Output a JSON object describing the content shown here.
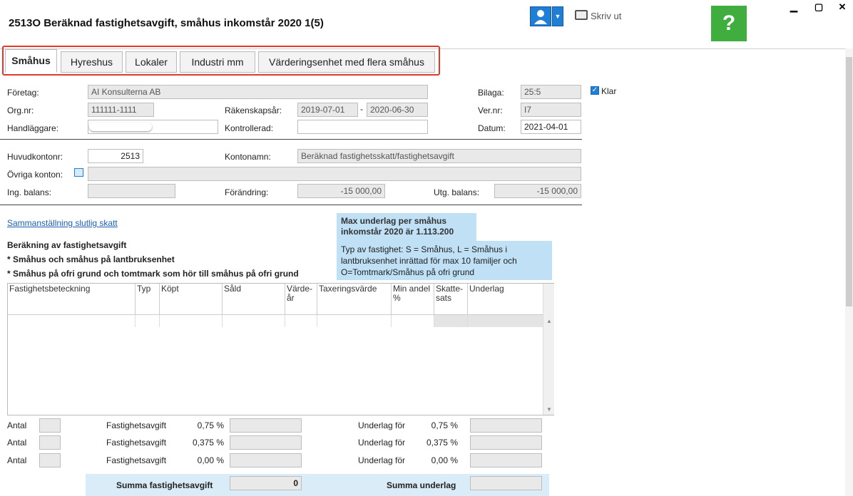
{
  "window": {
    "title": "2513O  Beräknad fastighetsavgift, småhus inkomstår 2020 1(5)",
    "minimize": "▁",
    "maximize": "▢",
    "close": "✕",
    "help": "?",
    "print_label": "Skriv ut"
  },
  "tabs": [
    "Småhus",
    "Hyreshus",
    "Lokaler",
    "Industri mm",
    "Värderingsenhet med flera småhus"
  ],
  "header_form": {
    "foretag_label": "Företag:",
    "foretag_value": "AI Konsulterna AB",
    "orgnr_label": "Org.nr:",
    "orgnr_value": "111111-1111",
    "handlaggare_label": "Handläggare:",
    "handlaggare_value": "",
    "rakenskapsar_label": "Räkenskapsår:",
    "rakenskapsar_from": "2019-07-01",
    "rakenskapsar_dash": "-",
    "rakenskapsar_to": "2020-06-30",
    "kontrollerad_label": "Kontrollerad:",
    "kontrollerad_value": "",
    "bilaga_label": "Bilaga:",
    "bilaga_value": "25:5",
    "vernr_label": "Ver.nr:",
    "vernr_value": "I7",
    "datum_label": "Datum:",
    "datum_value": "2021-04-01",
    "klar_label": "Klar",
    "klar_checked": true
  },
  "account_form": {
    "huvudkontonr_label": "Huvudkontonr:",
    "huvudkontonr_value": "2513",
    "kontonamn_label": "Kontonamn:",
    "kontonamn_value": "Beräknad fastighetsskatt/fastighetsavgift",
    "ovriga_label": "Övriga konton:",
    "ovriga_value": "",
    "ing_balans_label": "Ing. balans:",
    "ing_balans_value": "",
    "forandring_label": "Förändring:",
    "forandring_value": "-15 000,00",
    "utg_balans_label": "Utg. balans:",
    "utg_balans_value": "-15 000,00"
  },
  "calc": {
    "link": "Sammanställning slutlig skatt",
    "heading": "Beräkning av fastighetsavgift",
    "line1": "* Småhus och småhus på lantbruksenhet",
    "line2": "* Småhus på ofri grund och tomtmark som hör till småhus på ofri grund",
    "info_max": "Max underlag per småhus inkomstår 2020 är 1.113.200",
    "info_typ": "Typ av fastighet: S = Småhus, L = Småhus i lantbruksenhet inrättad för max 10 familjer och O=Tomtmark/Småhus på ofri grund"
  },
  "grid_headers": [
    "Fastighetsbeteckning",
    "Typ",
    "Köpt",
    "Såld",
    "Värde-år",
    "Taxeringsvärde",
    "Min andel %",
    "Skatte-sats",
    "Underlag"
  ],
  "summary_rows": [
    {
      "antal": "Antal",
      "avgift_label": "Fastighetsavgift",
      "avgift_pct": "0,75 %",
      "underlag_label": "Underlag för",
      "underlag_pct": "0,75 %"
    },
    {
      "antal": "Antal",
      "avgift_label": "Fastighetsavgift",
      "avgift_pct": "0,375 %",
      "underlag_label": "Underlag för",
      "underlag_pct": "0,375 %"
    },
    {
      "antal": "Antal",
      "avgift_label": "Fastighetsavgift",
      "avgift_pct": "0,00 %",
      "underlag_label": "Underlag för",
      "underlag_pct": "0,00 %"
    }
  ],
  "totals": {
    "summa_avgift_label": "Summa fastighetsavgift",
    "summa_avgift_value": "0",
    "summa_underlag_label": "Summa underlag",
    "summa_underlag_value": ""
  }
}
